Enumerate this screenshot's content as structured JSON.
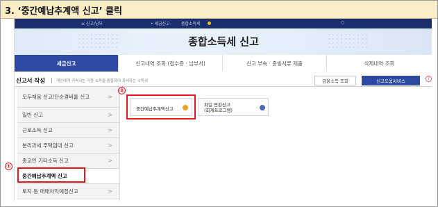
{
  "caption": "3. ‘중간예납추계액 신고’ 클릭",
  "topnav": {
    "items": [
      "≡ 신고/납부",
      "• 세금신고",
      "종합소득세",
      "○"
    ]
  },
  "banner": {
    "title": "종합소득세 신고"
  },
  "tabs": [
    {
      "label": "세금신고",
      "active": true
    },
    {
      "label": "신고내역 조회 (접수증 · 납부서)",
      "active": false
    },
    {
      "label": "신고 부속 · 증빙서류 제출",
      "active": false
    },
    {
      "label": "삭제내역 조회",
      "active": false
    }
  ],
  "subheader": {
    "title": "신고서 작성",
    "desc": "개인에게 귀속되는 각종 소득을 종합하여 과세하는 소득세",
    "btn_income": "금융소득 조회",
    "btn_help": "신고도움서비스",
    "help_icon": "?"
  },
  "sidebar": {
    "items": [
      {
        "label": "모두채움 신고/단순경비율 신고",
        "arrow": ">"
      },
      {
        "label": "일반 신고",
        "arrow": ">"
      },
      {
        "label": "근로소득 신고",
        "arrow": ">"
      },
      {
        "label": "분리과세 주택임대 신고",
        "arrow": ">"
      },
      {
        "label": "종교인 기타소득 신고",
        "arrow": ">"
      },
      {
        "label": "중간예납추계액 신고",
        "arrow": ""
      },
      {
        "label": "토지 등 매매차익예정신고",
        "arrow": ">"
      }
    ]
  },
  "cards": [
    {
      "label": "중간예납추계액신고"
    },
    {
      "label_line1": "파일 변환신고",
      "label_line2": "(회계프로그램)"
    }
  ],
  "markers": {
    "step1": "①",
    "step2": "②"
  },
  "colors": {
    "nav": "#1b2f6e",
    "accent": "#2c4aa0",
    "highlight": "#e8161c",
    "badge_orange": "#f0a020",
    "badge_blue": "#4a64c8"
  }
}
